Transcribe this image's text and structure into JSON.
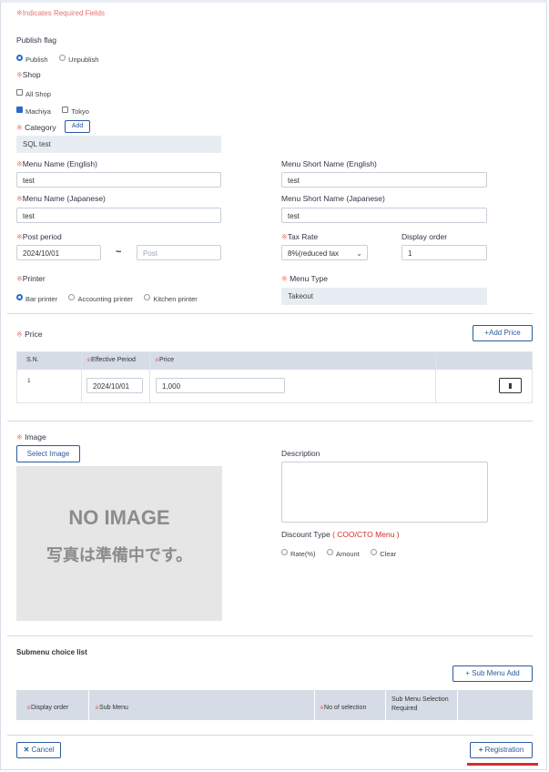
{
  "required_note": "Indicates Required Fields",
  "req_mark": "※",
  "publish": {
    "label": "Publish flag",
    "options": [
      "Publish",
      "Unpublish"
    ],
    "selected": "Publish"
  },
  "shop": {
    "label": "Shop",
    "all": "All Shop",
    "options": [
      {
        "name": "Machiya",
        "checked": true
      },
      {
        "name": "Tokyo",
        "checked": false
      }
    ]
  },
  "category": {
    "label": "Category",
    "add_label": "Add",
    "value": "SQL test"
  },
  "menu_name_en": {
    "label": "Menu Name (English)",
    "value": "test"
  },
  "menu_short_en": {
    "label": "Menu Short Name (English)",
    "value": "test"
  },
  "menu_name_ja": {
    "label": "Menu Name (Japanese)",
    "value": "test"
  },
  "menu_short_ja": {
    "label": "Menu Short Name (Japanese)",
    "value": "test"
  },
  "post_period": {
    "label": "Post period",
    "start": "2024/10/01",
    "separator": "~",
    "end_placeholder": "Post"
  },
  "tax_rate": {
    "label": "Tax Rate",
    "value": "8%(reduced tax"
  },
  "display_order": {
    "label": "Display order",
    "value": "1"
  },
  "printer": {
    "label": "Printer",
    "options": [
      "Bar printer",
      "Accounting printer",
      "Kitchen printer"
    ],
    "selected": "Bar printer"
  },
  "menu_type": {
    "label": "Menu Type",
    "value": "Takeout"
  },
  "price": {
    "label": "Price",
    "add_label": "+Add Price",
    "columns": [
      "S.N.",
      "Effective Period",
      "Price"
    ],
    "rows": [
      {
        "sn": "1",
        "period": "2024/10/01",
        "price": "1,000"
      }
    ]
  },
  "image": {
    "label": "Image",
    "select_label": "Select Image",
    "placeholder_en": "NO IMAGE",
    "placeholder_ja": "写真は準備中です。"
  },
  "description": {
    "label": "Description",
    "value": ""
  },
  "discount": {
    "label": "Discount Type",
    "note": "( COO/CTO Menu )",
    "options": [
      "Rate(%)",
      "Amount",
      "Clear"
    ]
  },
  "submenu": {
    "title": "Submenu choice list",
    "add_label": "+ Sub Menu Add",
    "columns": [
      "Display order",
      "Sub Menu",
      "No of selection",
      "Sub Menu Selection Required"
    ]
  },
  "footer": {
    "cancel_label": "Cancel",
    "register_label": "Registration"
  },
  "colors": {
    "accent": "#2b5aa0",
    "required": "#e57373",
    "header_bg": "#d5dce6",
    "highlight": "#d32f2f"
  }
}
